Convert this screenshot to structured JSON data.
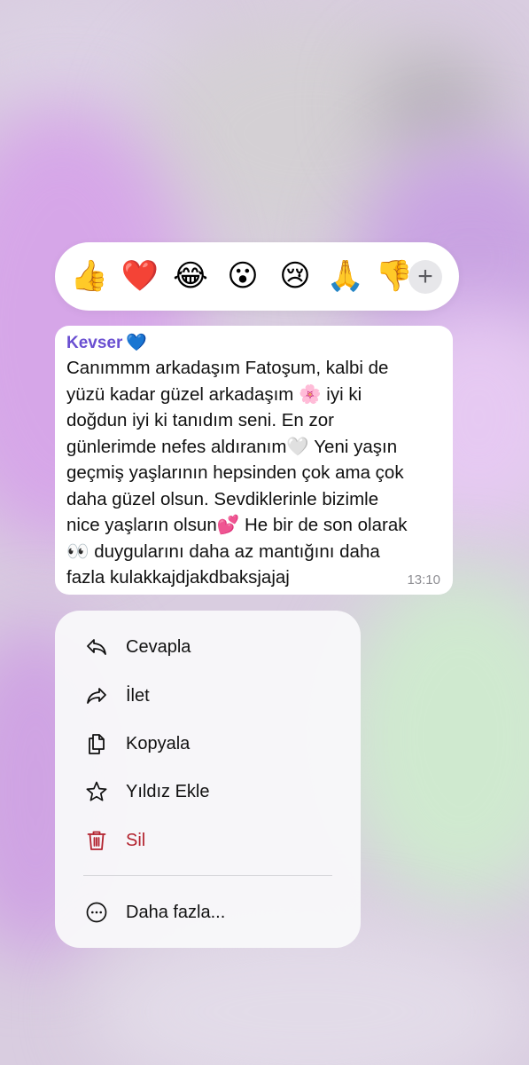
{
  "reactions": {
    "emojis": [
      "👍",
      "❤️",
      "😂",
      "😮",
      "😢",
      "🙏",
      "👎"
    ],
    "more_label": "+"
  },
  "message": {
    "sender": "Kevser",
    "sender_emoji": "💙",
    "lines": [
      "Canımmm arkadaşım Fatoşum, kalbi de",
      "yüzü kadar güzel arkadaşım 🌸  iyi ki",
      "doğdun iyi ki tanıdım seni. En zor",
      "günlerimde nefes aldıranım🤍  Yeni yaşın",
      "geçmiş yaşlarının hepsinden çok ama çok",
      "daha güzel olsun. Sevdiklerinle bizimle",
      "nice yaşların olsun💕  He bir de son olarak",
      "👀  duygularını daha az mantığını daha",
      "fazla kulakkajdjakdbaksjajaj"
    ],
    "time": "13:10"
  },
  "menu": {
    "items": [
      {
        "label": "Cevapla",
        "icon": "reply-icon"
      },
      {
        "label": "İlet",
        "icon": "forward-icon"
      },
      {
        "label": "Kopyala",
        "icon": "copy-icon"
      },
      {
        "label": "Yıldız Ekle",
        "icon": "star-icon"
      },
      {
        "label": "Sil",
        "icon": "trash-icon"
      }
    ],
    "more": {
      "label": "Daha fazla...",
      "icon": "more-icon"
    }
  },
  "colors": {
    "sender": "#6a4fd1",
    "danger": "#b3232f",
    "time": "#8e8e93"
  }
}
